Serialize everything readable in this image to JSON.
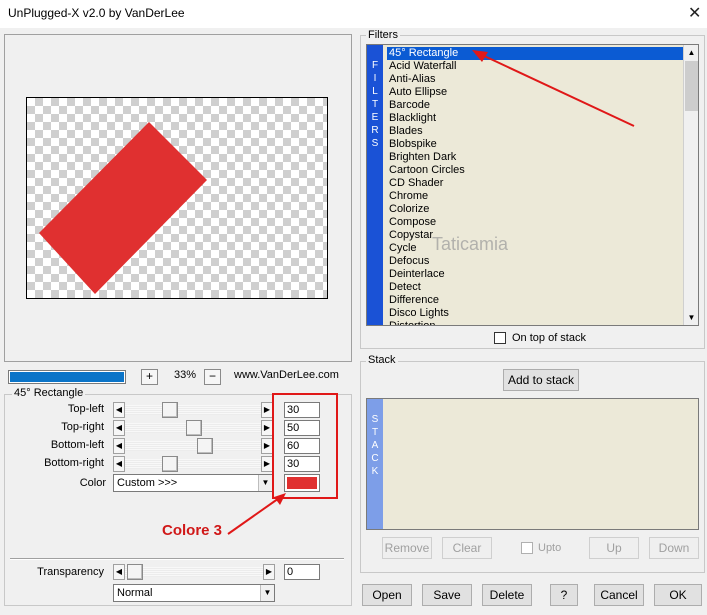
{
  "window": {
    "title": "UnPlugged-X v2.0 by VanDerLee",
    "close_label": "✕"
  },
  "preview": {
    "shape_color": "#e03030",
    "zoom": "33%",
    "zoom_in_label": "+",
    "zoom_out_label": "−",
    "site": "www.VanDerLee.com"
  },
  "params": {
    "group_label": "45° Rectangle",
    "sliders": [
      {
        "label": "Top-left",
        "value": "30"
      },
      {
        "label": "Top-right",
        "value": "50"
      },
      {
        "label": "Bottom-left",
        "value": "60"
      },
      {
        "label": "Bottom-right",
        "value": "30"
      }
    ],
    "color_label": "Color",
    "color_option": "Custom >>>",
    "swatch_color": "#e03030",
    "transparency_label": "Transparency",
    "transparency_value": "0",
    "blend_mode": "Normal"
  },
  "filters": {
    "group_label": "Filters",
    "side_letters": [
      "F",
      "I",
      "L",
      "T",
      "E",
      "R",
      "S"
    ],
    "items": [
      "45° Rectangle",
      "Acid Waterfall",
      "Anti-Alias",
      "Auto Ellipse",
      "Barcode",
      "Blacklight",
      "Blades",
      "Blobspike",
      "Brighten Dark",
      "Cartoon Circles",
      "CD Shader",
      "Chrome",
      "Colorize",
      "Compose",
      "Copystar",
      "Cycle",
      "Defocus",
      "Deinterlace",
      "Detect",
      "Difference",
      "Disco Lights",
      "Distortion"
    ],
    "selected_index": 0,
    "on_top_label": "On top of stack"
  },
  "stack": {
    "group_label": "Stack",
    "add_label": "Add to stack",
    "side_letters": [
      "S",
      "T",
      "A",
      "C",
      "K"
    ],
    "remove_label": "Remove",
    "clear_label": "Clear",
    "upto_label": "Upto",
    "up_label": "Up",
    "down_label": "Down"
  },
  "buttons": {
    "open": "Open",
    "save": "Save",
    "delete": "Delete",
    "help": "?",
    "cancel": "Cancel",
    "ok": "OK"
  },
  "annotation": {
    "text": "Colore 3"
  },
  "watermark": {
    "text": "Taticamia"
  }
}
